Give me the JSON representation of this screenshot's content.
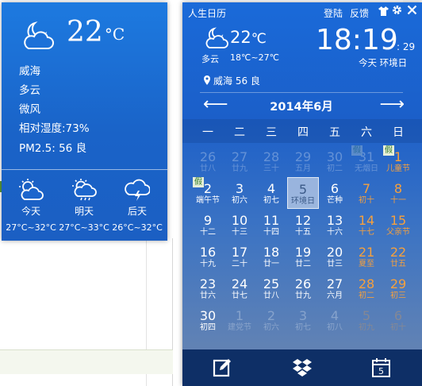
{
  "weather_popup": {
    "temperature": "22",
    "unit": "°C",
    "city": "威海",
    "condition": "多云",
    "wind": "微风",
    "humidity": "相对湿度:73%",
    "pm25": "PM2.5: 56 良",
    "forecast": [
      {
        "name": "今天",
        "range": "27°C~32°C",
        "icon": "partly-cloudy-icon"
      },
      {
        "name": "明天",
        "range": "27°C~33°C",
        "icon": "rain-sun-icon"
      },
      {
        "name": "后天",
        "range": "26°C~32°C",
        "icon": "thunderstorm-icon"
      }
    ]
  },
  "calendar": {
    "title": "人生日历",
    "login": "登陆",
    "feedback": "反馈",
    "icons": {
      "skin": "shirt-icon",
      "settings": "gear-icon",
      "close": "close-icon"
    },
    "temp": "22",
    "unit": "℃",
    "condition": "多云",
    "range": "18℃~27℃",
    "time": "18:19",
    "seconds": ": 29",
    "today_label": "今天 环境日",
    "location": "威海 56 良",
    "month": "2014年6月",
    "prev": "⟵",
    "next": "⟶",
    "weekdays": [
      "一",
      "二",
      "三",
      "四",
      "五",
      "六",
      "日"
    ],
    "holiday_badge": "假",
    "days": [
      {
        "d": "26",
        "l": "廿八",
        "other": true
      },
      {
        "d": "27",
        "l": "廿九",
        "other": true
      },
      {
        "d": "28",
        "l": "三十",
        "other": true
      },
      {
        "d": "29",
        "l": "五月",
        "other": true
      },
      {
        "d": "30",
        "l": "初二",
        "other": true
      },
      {
        "d": "31",
        "l": "无烟日",
        "other": true,
        "hol": true
      },
      {
        "d": "1",
        "l": "儿童节",
        "we": true,
        "hol": true
      },
      {
        "d": "2",
        "l": "端午节",
        "hol": true
      },
      {
        "d": "3",
        "l": "初六"
      },
      {
        "d": "4",
        "l": "初七"
      },
      {
        "d": "5",
        "l": "环境日",
        "today": true
      },
      {
        "d": "6",
        "l": "芒种"
      },
      {
        "d": "7",
        "l": "初十",
        "we": true
      },
      {
        "d": "8",
        "l": "十一",
        "we": true
      },
      {
        "d": "9",
        "l": "十二"
      },
      {
        "d": "10",
        "l": "十三"
      },
      {
        "d": "11",
        "l": "十四"
      },
      {
        "d": "12",
        "l": "十五"
      },
      {
        "d": "13",
        "l": "十六"
      },
      {
        "d": "14",
        "l": "十七",
        "we": true
      },
      {
        "d": "15",
        "l": "父亲节",
        "we": true
      },
      {
        "d": "16",
        "l": "十九"
      },
      {
        "d": "17",
        "l": "二十"
      },
      {
        "d": "18",
        "l": "廿一"
      },
      {
        "d": "19",
        "l": "廿二"
      },
      {
        "d": "20",
        "l": "廿三"
      },
      {
        "d": "21",
        "l": "夏至",
        "we": true
      },
      {
        "d": "22",
        "l": "廿五",
        "we": true
      },
      {
        "d": "23",
        "l": "廿六"
      },
      {
        "d": "24",
        "l": "廿七"
      },
      {
        "d": "25",
        "l": "廿八"
      },
      {
        "d": "26",
        "l": "廿九"
      },
      {
        "d": "27",
        "l": "六月"
      },
      {
        "d": "28",
        "l": "初二",
        "we": true
      },
      {
        "d": "29",
        "l": "初三",
        "we": true
      },
      {
        "d": "30",
        "l": "初四"
      },
      {
        "d": "1",
        "l": "建党节",
        "other": true
      },
      {
        "d": "2",
        "l": "初六",
        "other": true
      },
      {
        "d": "3",
        "l": "初七",
        "other": true
      },
      {
        "d": "4",
        "l": "初八",
        "other": true
      },
      {
        "d": "5",
        "l": "初九",
        "other": true,
        "we": true
      },
      {
        "d": "6",
        "l": "初十",
        "other": true,
        "we": true
      }
    ],
    "toolbar": [
      "edit-note-icon",
      "dropbox-icon",
      "calendar-5-icon"
    ]
  }
}
